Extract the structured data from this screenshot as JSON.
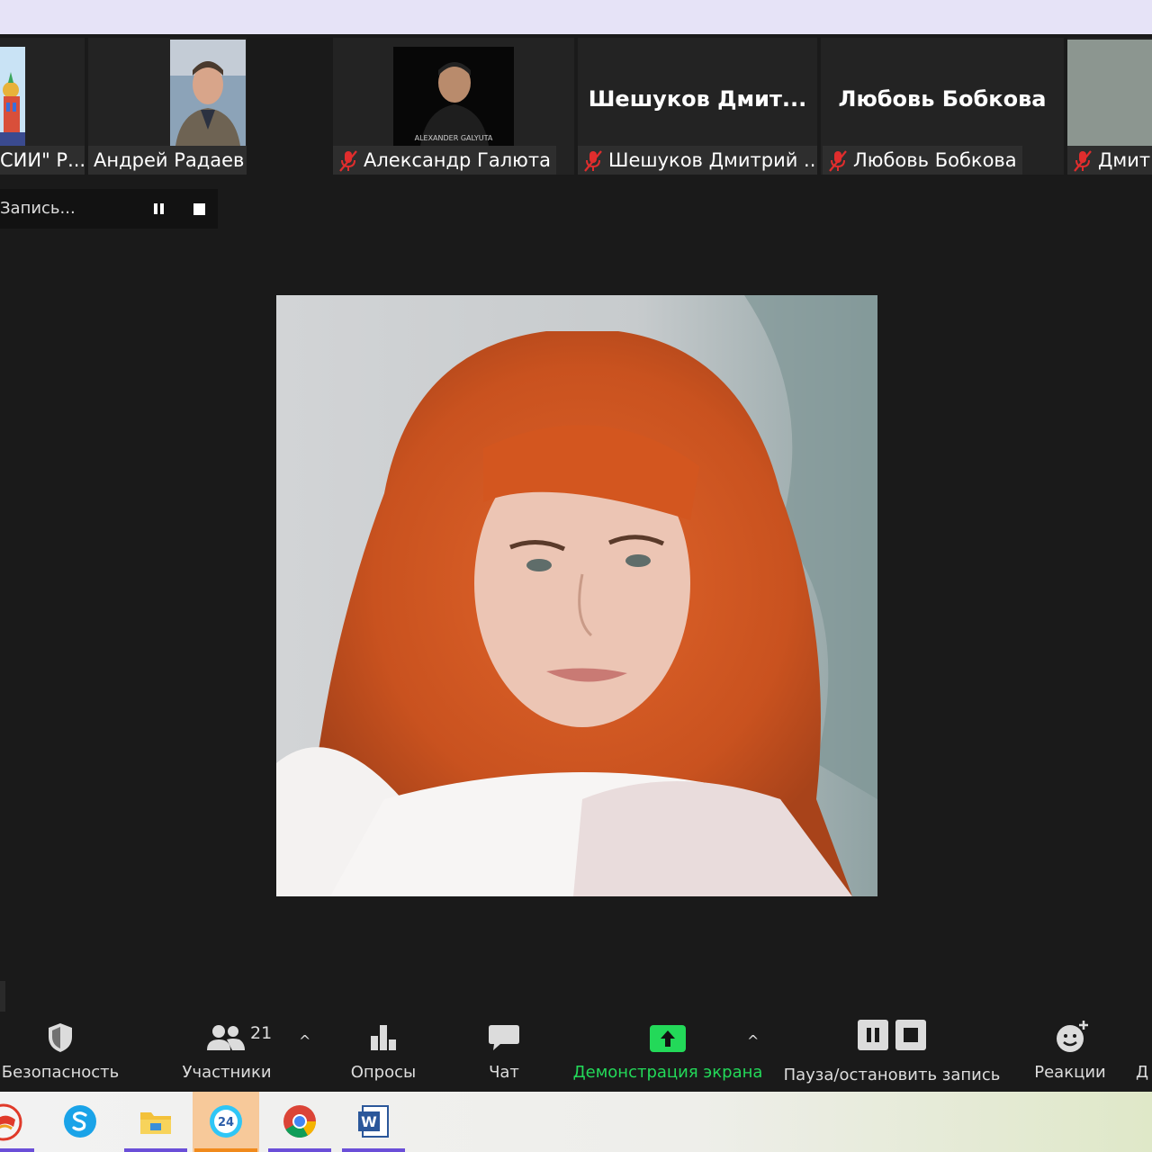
{
  "gallery": {
    "tiles": [
      {
        "name": "СИИ\" Р...",
        "muted": false
      },
      {
        "name": "Андрей Радаев",
        "muted": false
      },
      {
        "name": "Александр Галюта",
        "muted": true,
        "photo_caption": "ALEXANDER GALYUTA"
      },
      {
        "name": "Шешуков Дмитрий ...",
        "muted": true,
        "big_name": "Шешуков  Дмит..."
      },
      {
        "name": "Любовь Бобкова",
        "muted": true,
        "big_name": "Любовь Бобкова"
      },
      {
        "name": "Дмитр",
        "muted": true
      }
    ]
  },
  "recording": {
    "label": "Запись..."
  },
  "toolbar": {
    "security_label": "Безопасность",
    "participants_label": "Участники",
    "participants_count": "21",
    "polls_label": "Опросы",
    "chat_label": "Чат",
    "share_label": "Демонстрация экрана",
    "record_label": "Пауза/остановить запись",
    "reactions_label": "Реакции",
    "more_label": "Д",
    "caret": "^"
  },
  "taskbar": {
    "apps": [
      "yandex-browser",
      "skype",
      "file-explorer",
      "bitrix24",
      "chrome",
      "word"
    ],
    "bitrix_badge": "24",
    "word_glyph": "W"
  },
  "colors": {
    "background": "#1a1a1a",
    "share_green": "#23d959",
    "muted_red": "#e02d2d",
    "title_bar": "#e6e3f7"
  }
}
